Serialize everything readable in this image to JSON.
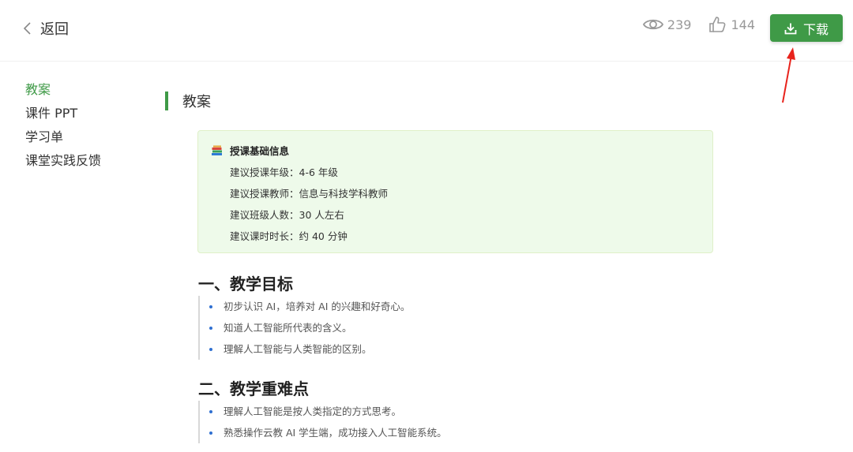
{
  "header": {
    "back_label": "返回",
    "views": "239",
    "likes": "144",
    "download_label": "下载"
  },
  "colors": {
    "accent": "#3f9a47",
    "info_bg": "#eefaea",
    "bullet": "#2f6fd1",
    "annotation_arrow": "#e8231c"
  },
  "sidebar": {
    "items": [
      {
        "label": "教案",
        "active": true
      },
      {
        "label": "课件 PPT"
      },
      {
        "label": "学习单"
      },
      {
        "label": "课堂实践反馈"
      }
    ]
  },
  "main": {
    "section_title": "教案",
    "info": {
      "icon": "books-icon",
      "title": "授课基础信息",
      "lines": [
        "建议授课年级：4-6 年级",
        "建议授课教师：信息与科技学科教师",
        "建议班级人数：30 人左右",
        "建议课时时长：约 40 分钟"
      ]
    },
    "goals": {
      "heading": "一、教学目标",
      "items": [
        "初步认识 AI，培养对 AI 的兴趣和好奇心。",
        "知道人工智能所代表的含义。",
        "理解人工智能与人类智能的区别。"
      ]
    },
    "key_points": {
      "heading": "二、教学重难点",
      "items": [
        "理解人工智能是按人类指定的方式思考。",
        "熟悉操作云教 AI 学生端，成功接入人工智能系统。"
      ]
    }
  }
}
